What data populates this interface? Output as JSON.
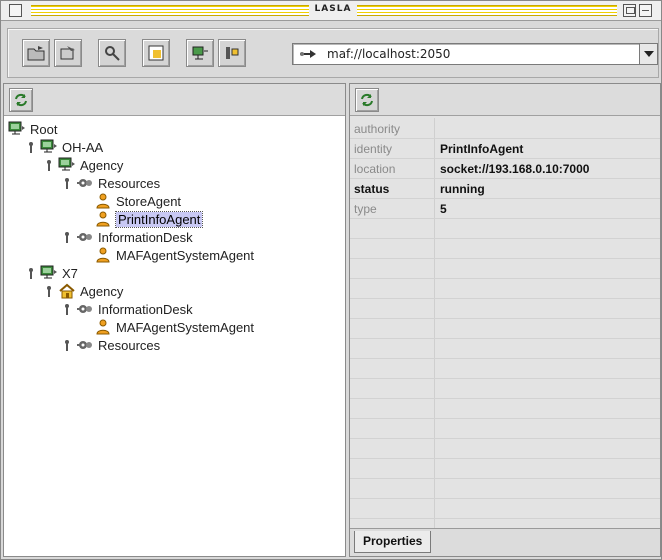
{
  "window": {
    "title": "LASLA"
  },
  "toolbar": {
    "buttons": [
      {
        "name": "open-icon"
      },
      {
        "name": "save-icon"
      },
      {
        "name": "search-icon"
      },
      {
        "name": "new-agent-icon"
      },
      {
        "name": "connect-icon"
      },
      {
        "name": "settings-icon"
      }
    ],
    "address": {
      "value": "maf://localhost:2050",
      "icon": "network-icon"
    }
  },
  "tree": {
    "nodes": [
      {
        "label": "Root",
        "icon": "computer-icon",
        "level": 0
      },
      {
        "label": "OH-AA",
        "icon": "computer-icon",
        "level": 1
      },
      {
        "label": "Agency",
        "icon": "computer-icon",
        "level": 2
      },
      {
        "label": "Resources",
        "icon": "cog-icon",
        "level": 3
      },
      {
        "label": "StoreAgent",
        "icon": "agent-icon",
        "level": 4
      },
      {
        "label": "PrintInfoAgent",
        "icon": "agent-icon",
        "level": 4,
        "selected": true
      },
      {
        "label": "InformationDesk",
        "icon": "cog-icon",
        "level": 3
      },
      {
        "label": "MAFAgentSystemAgent",
        "icon": "agent-icon",
        "level": 4
      },
      {
        "label": "X7",
        "icon": "computer-icon",
        "level": 1
      },
      {
        "label": "Agency",
        "icon": "house-icon",
        "level": 2
      },
      {
        "label": "InformationDesk",
        "icon": "cog-icon",
        "level": 3
      },
      {
        "label": "MAFAgentSystemAgent",
        "icon": "agent-icon",
        "level": 4
      },
      {
        "label": "Resources",
        "icon": "cog-icon",
        "level": 3
      }
    ]
  },
  "properties": {
    "rows": [
      {
        "key": "authority",
        "value": ""
      },
      {
        "key": "identity",
        "value": "PrintInfoAgent"
      },
      {
        "key": "location",
        "value": "socket://193.168.0.10:7000"
      },
      {
        "key": "status",
        "value": "running",
        "bold_key": true
      },
      {
        "key": "type",
        "value": "5"
      }
    ],
    "tab_label": "Properties"
  },
  "colors": {
    "title_stripe": "#f0d000",
    "selection": "#c9c9f4",
    "agent": "#f0a020",
    "computer": "#3a8a3a"
  }
}
